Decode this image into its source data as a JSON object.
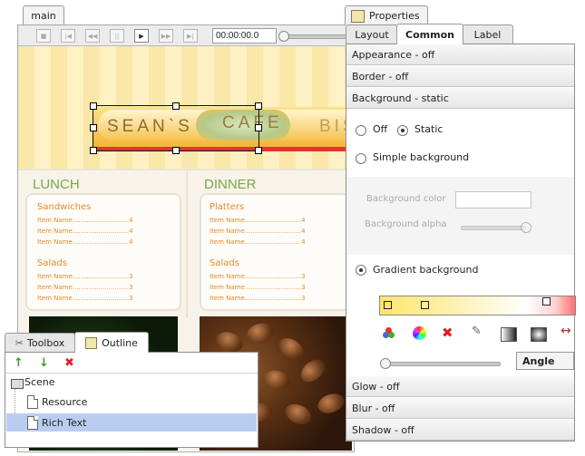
{
  "main_window": {
    "tab_label": "main",
    "time_value": "00:00:00.0",
    "transport": [
      "stop-icon",
      "skip-back-icon",
      "rewind-icon",
      "pause-icon",
      "play-icon",
      "fast-forward-icon",
      "skip-forward-icon"
    ]
  },
  "canvas": {
    "banner_words": [
      "SEAN`S",
      "CAFE",
      "BIS"
    ],
    "lunch": {
      "title": "LUNCH",
      "groups": [
        {
          "name": "Sandwiches",
          "items": [
            {
              "name": "Item Name",
              "price": "4"
            },
            {
              "name": "Item Name",
              "price": "4"
            },
            {
              "name": "Item Name",
              "price": "4"
            }
          ]
        },
        {
          "name": "Salads",
          "items": [
            {
              "name": "Item Name",
              "price": "3"
            },
            {
              "name": "Item Name",
              "price": "3"
            },
            {
              "name": "Item Name",
              "price": "3"
            }
          ]
        }
      ]
    },
    "dinner": {
      "title": "DINNER",
      "groups": [
        {
          "name": "Platters",
          "items": [
            {
              "name": "Item Name",
              "price": "4"
            },
            {
              "name": "Item Name",
              "price": "4"
            },
            {
              "name": "Item Name",
              "price": "4"
            }
          ]
        },
        {
          "name": "Salads",
          "items": [
            {
              "name": "Item Name",
              "price": "3"
            },
            {
              "name": "Item Name",
              "price": "3"
            },
            {
              "name": "Item Name",
              "price": "3"
            }
          ]
        }
      ]
    }
  },
  "properties": {
    "title": "Properties",
    "tabs": [
      "Layout",
      "Common",
      "Label"
    ],
    "active_tab": "Common",
    "sections": {
      "appearance": "Appearance - off",
      "border": "Border - off",
      "background": "Background - static",
      "glow": "Glow - off",
      "blur": "Blur - off",
      "shadow": "Shadow - off"
    },
    "background": {
      "off_label": "Off",
      "static_label": "Static",
      "simple_label": "Simple background",
      "color_label": "Background color",
      "alpha_label": "Background alpha",
      "gradient_label": "Gradient background",
      "angle_label": "Angle",
      "selected_mode": "Static",
      "selected_fill": "Gradient background"
    }
  },
  "toolbox": {
    "tabs": [
      "Toolbox",
      "Outline"
    ],
    "active_tab": "Outline"
  },
  "outline": {
    "tree": [
      {
        "label": "Scene",
        "type": "folder"
      },
      {
        "label": "Resource",
        "type": "file"
      },
      {
        "label": "Rich Text",
        "type": "file",
        "selected": true
      }
    ]
  },
  "colors": {
    "selection": "#b9cdf0",
    "menu_green": "#7aa842",
    "menu_orange": "#e48a2a",
    "banner_red": "#e3362b"
  }
}
